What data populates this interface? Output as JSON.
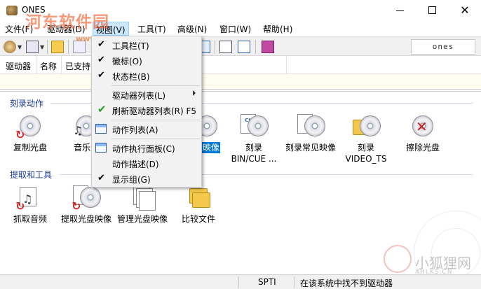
{
  "window": {
    "title": "ONES",
    "min": "",
    "max": "",
    "close": "✕"
  },
  "watermark": {
    "site": "河东软件园",
    "url": "www.pc0359.cn",
    "brand_cn": "小狐狸网",
    "brand_en": "XHLKS.CN"
  },
  "menu": [
    "文件(F)",
    "驱动器(D)",
    "视图(V)",
    "工具(T)",
    "高级(N)",
    "窗口(W)",
    "帮助(H)"
  ],
  "toolbar": {
    "brand": "ones"
  },
  "drives": {
    "columns": [
      "驱动器",
      "名称",
      "已支持"
    ]
  },
  "groups": {
    "burn": {
      "title": "刻录动作",
      "items": [
        {
          "label": "复制光盘"
        },
        {
          "label": "音乐光"
        },
        {
          "label": "盘映像"
        },
        {
          "label": "刻录",
          "label2": "BIN/CUE ..."
        },
        {
          "label": "刻录常见映像"
        },
        {
          "label": "刻录",
          "label2": "VIDEO_TS"
        },
        {
          "label": "擦除光盘"
        }
      ]
    },
    "extract": {
      "title": "提取和工具",
      "items": [
        {
          "label": "抓取音频"
        },
        {
          "label": "提取光盘映像"
        },
        {
          "label": "管理光盘映像"
        },
        {
          "label": "比较文件"
        }
      ]
    }
  },
  "view_menu": {
    "items": [
      {
        "label": "工具栏(T)",
        "checked": "✔"
      },
      {
        "label": "徽标(O)",
        "checked": "✔"
      },
      {
        "label": "状态栏(B)",
        "checked": "✔"
      },
      {
        "label": "驱动器列表(L)"
      },
      {
        "label": "刷新驱动器列表(R) F5",
        "check_icon": "✔"
      },
      {
        "label": "动作列表(A)"
      },
      {
        "label": "动作执行面板(C)"
      },
      {
        "label": "动作描述(D)"
      },
      {
        "label": "显示组(G)",
        "checked": "✔"
      }
    ]
  },
  "status": {
    "interface": "SPTI",
    "message": "在该系统中找不到驱动器"
  }
}
